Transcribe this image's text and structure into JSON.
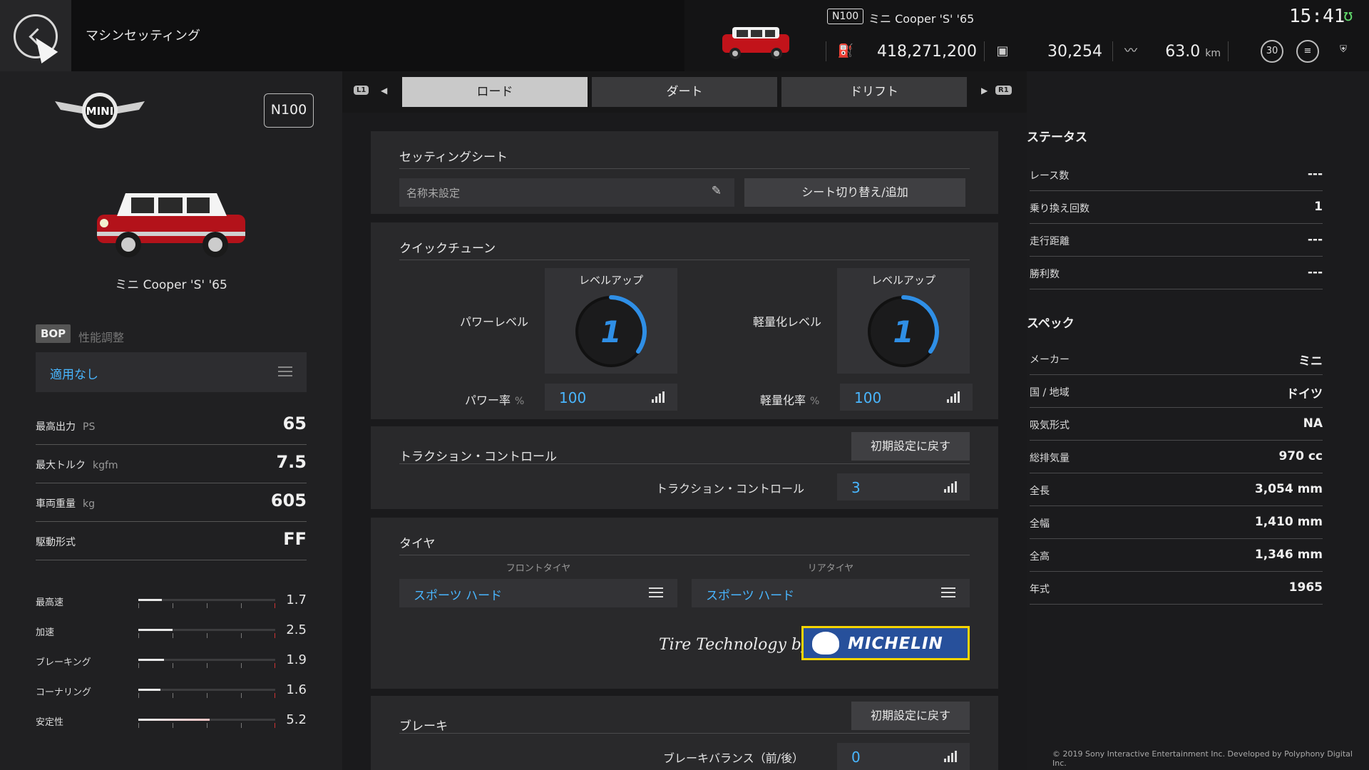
{
  "topbar": {
    "screen_title": "マシンセッティング",
    "class_badge": "N100",
    "car_name": "ミニ Cooper 'S' '65",
    "credits": "418,271,200",
    "mileage_points": "30,254",
    "odometer": "63.0",
    "odometer_unit": "km",
    "clock": "15:41",
    "level_badge": "30",
    "accent_green": "#5fd66a"
  },
  "car": {
    "class_label": "N100",
    "name": "ミニ Cooper 'S' '65",
    "body_color": "#c2131a",
    "brand_logo_text": "MINI"
  },
  "bop": {
    "tag": "BOP",
    "label": "性能調整",
    "value": "適用なし"
  },
  "specs_left": [
    {
      "label": "最高出力",
      "unit": "PS",
      "value": "65"
    },
    {
      "label": "最大トルク",
      "unit": "kgfm",
      "value": "7.5"
    },
    {
      "label": "車両重量",
      "unit": "kg",
      "value": "605"
    },
    {
      "label": "駆動形式",
      "unit": "",
      "value": "FF"
    }
  ],
  "performance": [
    {
      "label": "最高速",
      "value": "1.7",
      "level": 0.17
    },
    {
      "label": "加速",
      "value": "2.5",
      "level": 0.25
    },
    {
      "label": "ブレーキング",
      "value": "1.9",
      "level": 0.19
    },
    {
      "label": "コーナリング",
      "value": "1.6",
      "level": 0.16
    },
    {
      "label": "安定性",
      "value": "5.2",
      "level": 0.52
    }
  ],
  "tabs": {
    "left_btn": "L1",
    "right_btn": "R1",
    "items": [
      "ロード",
      "ダート",
      "ドリフト"
    ],
    "active_index": 0
  },
  "setting_sheet": {
    "title": "セッティングシート",
    "name_placeholder": "名称未設定",
    "switch_button": "シート切り替え/追加"
  },
  "quick_tune": {
    "title": "クイックチューン",
    "power": {
      "label": "パワーレベル",
      "dial_title": "レベルアップ",
      "level": "1",
      "rate_label": "パワー率",
      "rate_unit": "%",
      "rate_value": "100"
    },
    "weight": {
      "label": "軽量化レベル",
      "dial_title": "レベルアップ",
      "level": "1",
      "rate_label": "軽量化率",
      "rate_unit": "%",
      "rate_value": "100"
    },
    "dial_color": "#2f8fe6"
  },
  "traction": {
    "title": "トラクション・コントロール",
    "reset_button": "初期設定に戻す",
    "field_label": "トラクション・コントロール",
    "value": "3"
  },
  "tires": {
    "title": "タイヤ",
    "front_label": "フロントタイヤ",
    "rear_label": "リアタイヤ",
    "front_value": "スポーツ ハード",
    "rear_value": "スポーツ ハード",
    "tech_text": "Tire Technology by",
    "brand": "MICHELIN"
  },
  "brake": {
    "title": "ブレーキ",
    "reset_button": "初期設定に戻す",
    "field_label": "ブレーキバランス（前/後）",
    "value": "0"
  },
  "status": {
    "title": "ステータス",
    "rows": [
      {
        "k": "レース数",
        "v": "---"
      },
      {
        "k": "乗り換え回数",
        "v": "1"
      },
      {
        "k": "走行距離",
        "v": "---"
      },
      {
        "k": "勝利数",
        "v": "---"
      }
    ]
  },
  "spec": {
    "title": "スペック",
    "rows": [
      {
        "k": "メーカー",
        "v": "ミニ"
      },
      {
        "k": "国 / 地域",
        "v": "ドイツ"
      },
      {
        "k": "吸気形式",
        "v": "NA"
      },
      {
        "k": "総排気量",
        "v": "970 cc"
      },
      {
        "k": "全長",
        "v": "3,054 mm"
      },
      {
        "k": "全幅",
        "v": "1,410 mm"
      },
      {
        "k": "全高",
        "v": "1,346 mm"
      },
      {
        "k": "年式",
        "v": "1965"
      }
    ]
  },
  "copyright": "© 2019 Sony Interactive Entertainment Inc. Developed by Polyphony Digital Inc."
}
